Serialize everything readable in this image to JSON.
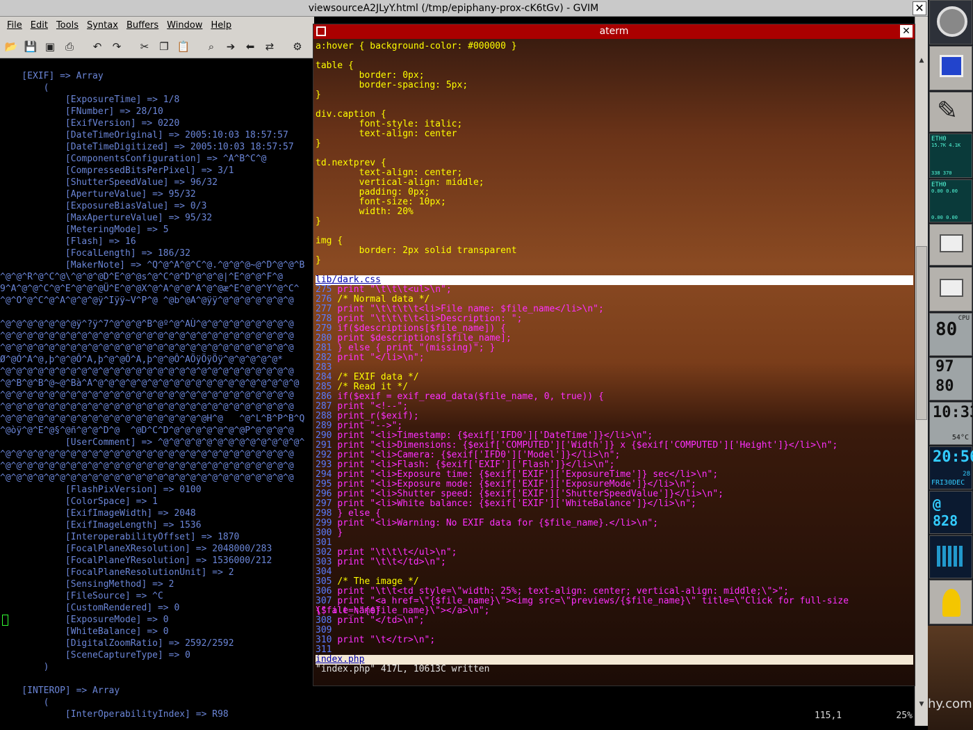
{
  "gvim": {
    "title": "viewsourceA2JLyY.html (/tmp/epiphany-prox-cK6tGv) - GVIM",
    "menu": [
      "File",
      "Edit",
      "Tools",
      "Syntax",
      "Buffers",
      "Window",
      "Help"
    ],
    "toolbar_icons": [
      "open-icon",
      "save-icon",
      "save-all-icon",
      "print-icon",
      "undo-icon",
      "redo-icon",
      "cut-icon",
      "copy-icon",
      "paste-icon",
      "find-icon",
      "forward-icon",
      "back-icon",
      "replace-icon",
      "build-icon"
    ],
    "text_lines": [
      "",
      "    [EXIF] => Array",
      "        (",
      "            [ExposureTime] => 1/8",
      "            [FNumber] => 28/10",
      "            [ExifVersion] => 0220",
      "            [DateTimeOriginal] => 2005:10:03 18:57:57",
      "            [DateTimeDigitized] => 2005:10:03 18:57:57",
      "            [ComponentsConfiguration] => ^A^B^C^@",
      "            [CompressedBitsPerPixel] => 3/1",
      "            [ShutterSpeedValue] => 96/32",
      "            [ApertureValue] => 95/32",
      "            [ExposureBiasValue] => 0/3",
      "            [MaxApertureValue] => 95/32",
      "            [MeteringMode] => 5",
      "            [Flash] => 16",
      "            [FocalLength] => 186/32",
      "            [MakerNote] => ^Q^@^A^@^C^@.^@^@^@~@^D^@^@^B",
      "^@^@^R^@^C^@\\^@^@^@D^E^@^@s^@^C^@^D^@^@^@|^E^@^@^F^@",
      "9^A^@^@^C^@^E^@^@^@Ü^E^@^@X^@^A^@^@^A^@^@æ^E^@^@^Y^@^C^",
      "^@^O^@^C^@^A^@^@^@ÿ^Iÿÿ~V^P^@ ^@b^@A^@ÿÿ^@^@^@^@^@^@^@",
      "",
      "^@^@^@^@^@^@^@ÿ^?ÿ^7^@^@^@^B^@º^@^AÙ^@^@^@^@^@^@^@^@^@",
      "^@^@^@^@^@^@^@^@^@^@^@^@^@^@^@^@^@^@^@^@^@^@^@^@^@^@^@",
      "^@^@^@^@^@^@^@^@^@^@^@^@^@^@^@^@^@^@^@^@^@^@^@^@^@^@^@",
      "Ø^@Ó^A^@,þ^@^@Ô^A,þ^@^@Ô^A,þ^@^@Ô^AÖÿÖÿÖÿ^@^@^@^@^@*",
      "^@^@^@^@^@^@^@^@^@^@^@^@^@^@^@^@^@^@^@^@^@^@^@^@^@^@^@",
      "^@^B^@^B^@~@^Bà^A^@^@^@^@^@^@^@^@^@^@^@^@^@^@^@^@^@^@^@",
      "^@^@^@^@^@^@^@^@^@^@^@^@^@^@^@^@^@^@^@^@^@^@^@^@^@^@^@",
      "^@^@^@^@^@^@^@^@^@^@^@^@^@^@^@^@^@^@^@^@^@^@^@^@^@^@^@",
      "^@^@^@^@^@^@^@^@^@^@^@^@^@^@^@^@^@^@^@H^@   ^@^L^B^P^B^Q",
      "^@òÿ^@^E^@§^@ñ^@^@^D^@  ^@D^C^D^@^@^@^@^@^@^@P^@^@^@^@",
      "            [UserComment] => ^@^@^@^@^@^@^@^@^@^@^@^@^@^",
      "^@^@^@^@^@^@^@^@^@^@^@^@^@^@^@^@^@^@^@^@^@^@^@^@^@^@^@",
      "^@^@^@^@^@^@^@^@^@^@^@^@^@^@^@^@^@^@^@^@^@^@^@^@^@^@^@",
      "^@^@^@^@^@^@^@^@^@^@^@^@^@^@^@^@^@^@^@^@^@^@^@^@^@^@^@",
      "            [FlashPixVersion] => 0100",
      "            [ColorSpace] => 1",
      "            [ExifImageWidth] => 2048",
      "            [ExifImageLength] => 1536",
      "            [InteroperabilityOffset] => 1870",
      "            [FocalPlaneXResolution] => 2048000/283",
      "            [FocalPlaneYResolution] => 1536000/212",
      "            [FocalPlaneResolutionUnit] => 2",
      "            [SensingMethod] => 2",
      "            [FileSource] => ^C",
      "            [CustomRendered] => 0",
      "            [ExposureMode] => 0",
      "            [WhiteBalance] => 0",
      "            [DigitalZoomRatio] => 2592/2592",
      "            [SceneCaptureType] => 0",
      "        )",
      "",
      "    [INTEROP] => Array",
      "        (",
      "            [InterOperabilityIndex] => R98"
    ],
    "status_position": "115,1",
    "status_percent": "25%"
  },
  "aterm": {
    "title": "aterm",
    "css_lines": [
      "a:hover { background-color: #000000 }",
      "",
      "table {",
      "        border: 0px;",
      "        border-spacing: 5px;",
      "}",
      "",
      "div.caption {",
      "        font-style: italic;",
      "        text-align: center",
      "}",
      "",
      "td.nextprev {",
      "        text-align: center;",
      "        vertical-align: middle;",
      "        padding: 0px;",
      "        font-size: 10px;",
      "        width: 20%",
      "}",
      "",
      "img {",
      "        border: 2px solid transparent",
      "}"
    ],
    "status_top": "lib/dark.css",
    "php_lines": [
      {
        "n": "275",
        "t": "                print \"\\t\\t\\t<ul>\\n\";"
      },
      {
        "n": "276",
        "t": "                /* Normal data */"
      },
      {
        "n": "277",
        "t": "                print \"\\t\\t\\t\\t<li>File name: $file_name</li>\\n\";"
      },
      {
        "n": "278",
        "t": "                print \"\\t\\t\\t\\t<li>Description: \";"
      },
      {
        "n": "279",
        "t": "                if($descriptions[$file_name]) {"
      },
      {
        "n": "280",
        "t": "                        print $descriptions[$file_name];"
      },
      {
        "n": "281",
        "t": "                } else { print \"(missing)\"; }"
      },
      {
        "n": "282",
        "t": "                print \"</li>\\n\";"
      },
      {
        "n": "283",
        "t": ""
      },
      {
        "n": "284",
        "t": "                /* EXIF data */"
      },
      {
        "n": "285",
        "t": "                /* Read it */"
      },
      {
        "n": "286",
        "t": "                if($exif = exif_read_data($file_name, 0, true)) {"
      },
      {
        "n": "287",
        "t": "                        print \"<!--\";"
      },
      {
        "n": "288",
        "t": "                        print_r($exif);"
      },
      {
        "n": "289",
        "t": "                        print \"-->\";"
      },
      {
        "n": "290",
        "t": "                        print \"<li>Timestamp: {$exif['IFD0']['DateTime']}</li>\\n\";"
      },
      {
        "n": "291",
        "t": "                        print \"<li>Dimensions: {$exif['COMPUTED']['Width']} x {$exif['COMPUTED']['Height']}</li>\\n\";"
      },
      {
        "n": "292",
        "t": "                        print \"<li>Camera: {$exif['IFD0']['Model']}</li>\\n\";"
      },
      {
        "n": "293",
        "t": "                        print \"<li>Flash: {$exif['EXIF']['Flash']}</li>\\n\";"
      },
      {
        "n": "294",
        "t": "                        print \"<li>Exposure time: {$exif['EXIF']['ExposureTime']} sec</li>\\n\";"
      },
      {
        "n": "295",
        "t": "                        print \"<li>Exposure mode: {$exif['EXIF']['ExposureMode']}</li>\\n\";"
      },
      {
        "n": "296",
        "t": "                        print \"<li>Shutter speed: {$exif['EXIF']['ShutterSpeedValue']}</li>\\n\";"
      },
      {
        "n": "297",
        "t": "                        print \"<li>White balance: {$exif['EXIF']['WhiteBalance']}</li>\\n\";"
      },
      {
        "n": "298",
        "t": "                } else {"
      },
      {
        "n": "299",
        "t": "                        print \"<li>Warning: No EXIF data for {$file_name}.</li>\\n\";"
      },
      {
        "n": "300",
        "t": "                }"
      },
      {
        "n": "301",
        "t": ""
      },
      {
        "n": "302",
        "t": "                print \"\\t\\t\\t</ul>\\n\";"
      },
      {
        "n": "303",
        "t": "                print \"\\t\\t</td>\\n\";"
      },
      {
        "n": "304",
        "t": ""
      },
      {
        "n": "305",
        "t": "                /* The image */"
      },
      {
        "n": "306",
        "t": "                print \"\\t\\t<td style=\\\"width: 25%; text-align: center; vertical-align: middle;\\\">\";"
      },
      {
        "n": "307",
        "t": "                print \"<a href=\\\"{$file_name}\\\"><img src=\\\"previews/{$file_name}\\\" title=\\\"Click for full-size {$file_name}"
      },
      {
        "n": "",
        "t": "\\\" alt=\\\"{$file_name}\\\"></a>\\n\";"
      },
      {
        "n": "308",
        "t": "                print \"</td>\\n\";"
      },
      {
        "n": "309",
        "t": ""
      },
      {
        "n": "310",
        "t": "                print \"\\t</tr>\\n\";"
      },
      {
        "n": "311",
        "t": ""
      }
    ],
    "status_bottom": "index.php",
    "message": "\"index.php\" 417L, 10613C written"
  },
  "dock": {
    "net1_label": "ETH0",
    "net1_values": "15.7K  4.1K",
    "net1_bottom": "338   370",
    "net2_label": "ETH0",
    "net2_values": "0.00  0.00",
    "net2_bottom": "0.00  0.00",
    "cpu_label": "CPU",
    "cpu_value": "80",
    "mem_value1": "97",
    "mem_value2": "80",
    "clock_time": "10:33",
    "temp": "54°C",
    "clock2_time": "20:56",
    "date": "FRI30DEC",
    "date_num": "28",
    "swatch": "@ 828",
    "watermark": "hy.com"
  }
}
